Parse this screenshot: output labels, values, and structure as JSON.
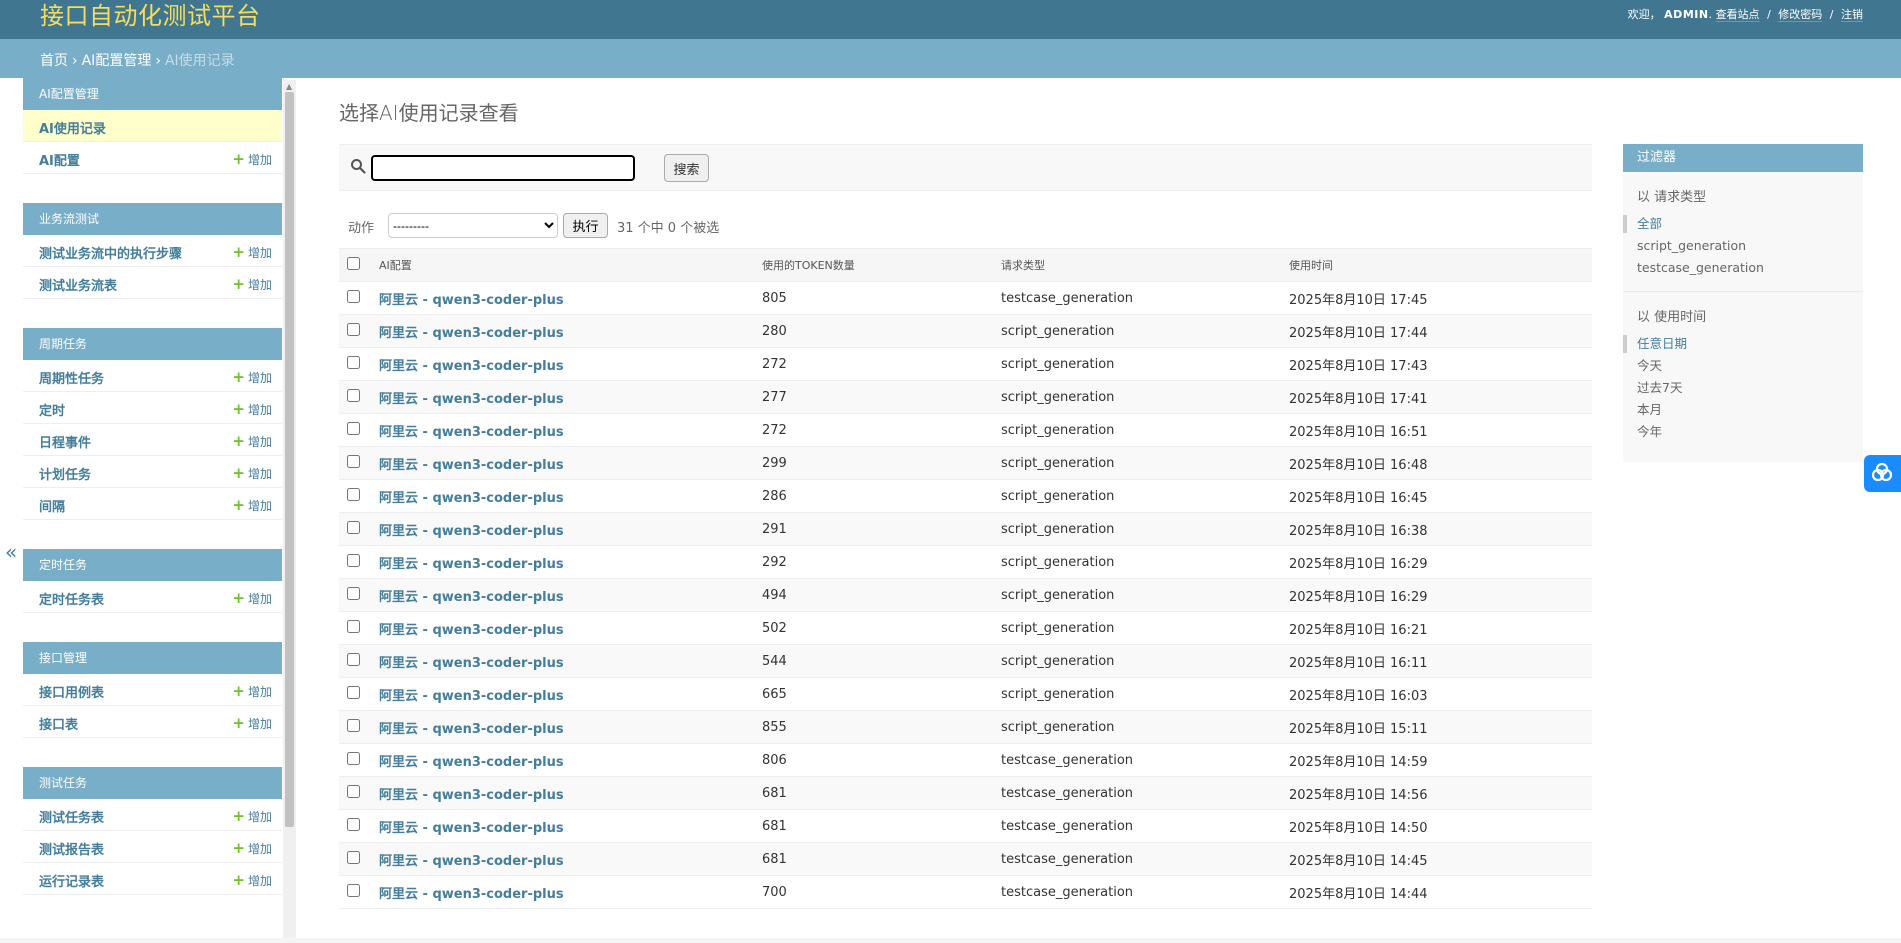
{
  "header": {
    "brand": "接口自动化测试平台",
    "welcome": "欢迎，",
    "username": "ADMIN",
    "period": ".",
    "view_site": "查看站点",
    "change_password": "修改密码",
    "logout": "注销",
    "sep": "/"
  },
  "breadcrumbs": {
    "home": "首页",
    "app": "AI配置管理",
    "current": "AI使用记录",
    "sep": "›"
  },
  "sidebar": {
    "toggle": "«",
    "add_label": "增加",
    "modules": [
      {
        "caption": "AI配置管理",
        "items": [
          "AI使用记录",
          "AI配置"
        ]
      },
      {
        "caption": "业务流测试",
        "items": [
          "测试业务流中的执行步骤",
          "测试业务流表"
        ]
      },
      {
        "caption": "周期任务",
        "items": [
          "周期性任务",
          "定时",
          "日程事件",
          "计划任务",
          "间隔"
        ]
      },
      {
        "caption": "定时任务",
        "items": [
          "定时任务表"
        ]
      },
      {
        "caption": "接口管理",
        "items": [
          "接口用例表",
          "接口表"
        ]
      },
      {
        "caption": "测试任务",
        "items": [
          "测试任务表",
          "测试报告表",
          "运行记录表"
        ]
      }
    ]
  },
  "content": {
    "title": "选择AI使用记录查看"
  },
  "search": {
    "value": "",
    "button": "搜索"
  },
  "actions": {
    "label": "动作",
    "selected": "---------",
    "go": "执行",
    "counter": "31 个中 0 个被选"
  },
  "table": {
    "headers": [
      "AI配置",
      "使用的TOKEN数量",
      "请求类型",
      "使用时间"
    ],
    "rows": [
      [
        "阿里云 - qwen3-coder-plus",
        "805",
        "testcase_generation",
        "2025年8月10日 17:45"
      ],
      [
        "阿里云 - qwen3-coder-plus",
        "280",
        "script_generation",
        "2025年8月10日 17:44"
      ],
      [
        "阿里云 - qwen3-coder-plus",
        "272",
        "script_generation",
        "2025年8月10日 17:43"
      ],
      [
        "阿里云 - qwen3-coder-plus",
        "277",
        "script_generation",
        "2025年8月10日 17:41"
      ],
      [
        "阿里云 - qwen3-coder-plus",
        "272",
        "script_generation",
        "2025年8月10日 16:51"
      ],
      [
        "阿里云 - qwen3-coder-plus",
        "299",
        "script_generation",
        "2025年8月10日 16:48"
      ],
      [
        "阿里云 - qwen3-coder-plus",
        "286",
        "script_generation",
        "2025年8月10日 16:45"
      ],
      [
        "阿里云 - qwen3-coder-plus",
        "291",
        "script_generation",
        "2025年8月10日 16:38"
      ],
      [
        "阿里云 - qwen3-coder-plus",
        "292",
        "script_generation",
        "2025年8月10日 16:29"
      ],
      [
        "阿里云 - qwen3-coder-plus",
        "494",
        "script_generation",
        "2025年8月10日 16:29"
      ],
      [
        "阿里云 - qwen3-coder-plus",
        "502",
        "script_generation",
        "2025年8月10日 16:21"
      ],
      [
        "阿里云 - qwen3-coder-plus",
        "544",
        "script_generation",
        "2025年8月10日 16:11"
      ],
      [
        "阿里云 - qwen3-coder-plus",
        "665",
        "script_generation",
        "2025年8月10日 16:03"
      ],
      [
        "阿里云 - qwen3-coder-plus",
        "855",
        "script_generation",
        "2025年8月10日 15:11"
      ],
      [
        "阿里云 - qwen3-coder-plus",
        "806",
        "testcase_generation",
        "2025年8月10日 14:59"
      ],
      [
        "阿里云 - qwen3-coder-plus",
        "681",
        "testcase_generation",
        "2025年8月10日 14:56"
      ],
      [
        "阿里云 - qwen3-coder-plus",
        "681",
        "testcase_generation",
        "2025年8月10日 14:50"
      ],
      [
        "阿里云 - qwen3-coder-plus",
        "681",
        "testcase_generation",
        "2025年8月10日 14:45"
      ],
      [
        "阿里云 - qwen3-coder-plus",
        "700",
        "testcase_generation",
        "2025年8月10日 14:44"
      ]
    ]
  },
  "filter": {
    "title": "过滤器",
    "groups": [
      {
        "title": "以 请求类型",
        "options": [
          "全部",
          "script_generation",
          "testcase_generation"
        ],
        "selected": 0
      },
      {
        "title": "以 使用时间",
        "options": [
          "任意日期",
          "今天",
          "过去7天",
          "本月",
          "今年"
        ],
        "selected": 0
      }
    ]
  },
  "colors": {
    "header": "#417690",
    "brand": "#f5dd5d",
    "breadcrumbs": "#79aec8",
    "link": "#447e9b",
    "current_row": "#ffffcc",
    "add_plus": "#70bf2b"
  }
}
